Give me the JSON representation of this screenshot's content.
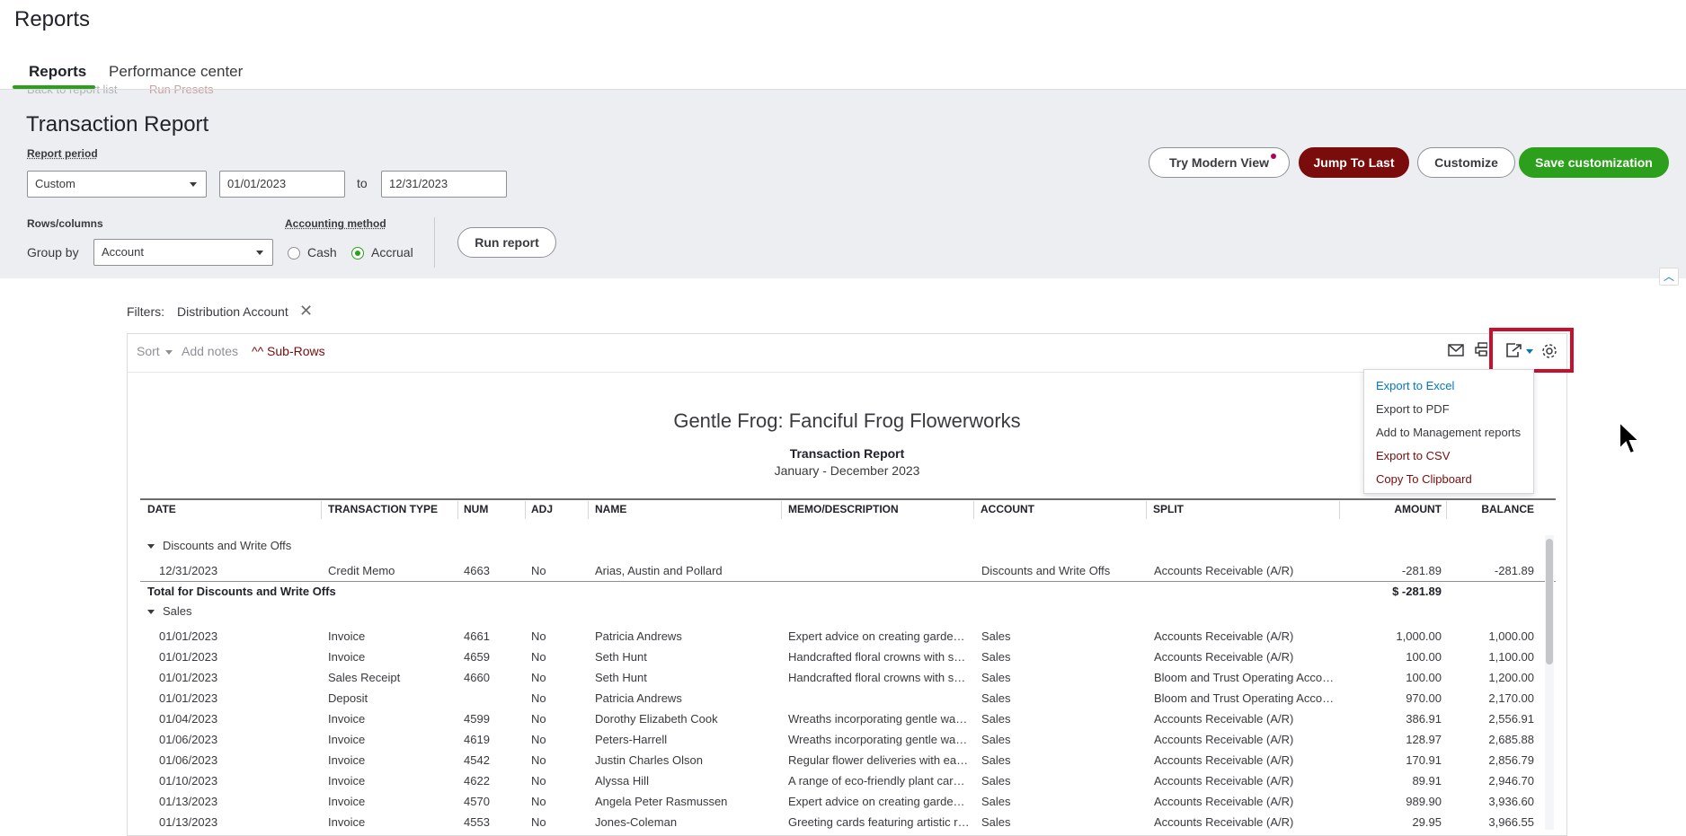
{
  "page_title": "Reports",
  "tabs": [
    {
      "label": "Reports",
      "active": true
    },
    {
      "label": "Performance center",
      "active": false
    }
  ],
  "breadcrumbs": {
    "back": "Back to report list",
    "presets": "Run Presets"
  },
  "report_heading": "Transaction Report",
  "report_period": {
    "label": "Report period",
    "selected": "Custom",
    "start_date": "01/01/2023",
    "to_label": "to",
    "end_date": "12/31/2023"
  },
  "rows_columns": {
    "label": "Rows/columns",
    "group_by_label": "Group by",
    "group_by_value": "Account"
  },
  "accounting_method": {
    "label": "Accounting method",
    "options": [
      "Cash",
      "Accrual"
    ],
    "selected": "Accrual"
  },
  "run_report_label": "Run report",
  "actions": {
    "modern_view": "Try Modern View",
    "jump_to_last": "Jump To Last",
    "customize": "Customize",
    "save_customization": "Save customization"
  },
  "filters": {
    "label": "Filters:",
    "chip": "Distribution Account",
    "remove": "✕"
  },
  "toolbar": {
    "sort": "Sort",
    "add_notes": "Add notes",
    "sub_rows": "^^ Sub-Rows",
    "icons": [
      "email-icon",
      "print-icon",
      "export-icon",
      "settings-icon"
    ]
  },
  "export_menu": [
    "Export to Excel",
    "Export to PDF",
    "Add to Management reports",
    "Export to CSV",
    "Copy To Clipboard"
  ],
  "report": {
    "company": "Gentle Frog: Fanciful Frog Flowerworks",
    "title": "Transaction Report",
    "date_range": "January - December 2023",
    "columns": [
      "DATE",
      "TRANSACTION TYPE",
      "NUM",
      "ADJ",
      "NAME",
      "MEMO/DESCRIPTION",
      "ACCOUNT",
      "SPLIT",
      "AMOUNT",
      "BALANCE"
    ],
    "groups": [
      {
        "name": "Discounts and Write Offs",
        "rows": [
          [
            "12/31/2023",
            "Credit Memo",
            "4663",
            "No",
            "Arias, Austin and Pollard",
            "",
            "Discounts and Write Offs",
            "Accounts Receivable (A/R)",
            "-281.89",
            "-281.89"
          ]
        ],
        "total_label": "Total for Discounts and Write Offs",
        "total_value": "$ -281.89"
      },
      {
        "name": "Sales",
        "rows": [
          [
            "01/01/2023",
            "Invoice",
            "4661",
            "No",
            "Patricia Andrews",
            "Expert advice on creating garde…",
            "Sales",
            "Accounts Receivable (A/R)",
            "1,000.00",
            "1,000.00"
          ],
          [
            "01/01/2023",
            "Invoice",
            "4659",
            "No",
            "Seth Hunt",
            "Handcrafted floral crowns with s…",
            "Sales",
            "Accounts Receivable (A/R)",
            "100.00",
            "1,100.00"
          ],
          [
            "01/01/2023",
            "Sales Receipt",
            "4660",
            "No",
            "Seth Hunt",
            "Handcrafted floral crowns with s…",
            "Sales",
            "Bloom and Trust Operating Acco…",
            "100.00",
            "1,200.00"
          ],
          [
            "01/01/2023",
            "Deposit",
            "",
            "No",
            "Patricia Andrews",
            "",
            "Sales",
            "Bloom and Trust Operating Acco…",
            "970.00",
            "2,170.00"
          ],
          [
            "01/04/2023",
            "Invoice",
            "4599",
            "No",
            "Dorothy Elizabeth Cook",
            "Wreaths incorporating gentle wa…",
            "Sales",
            "Accounts Receivable (A/R)",
            "386.91",
            "2,556.91"
          ],
          [
            "01/06/2023",
            "Invoice",
            "4619",
            "No",
            "Peters-Harrell",
            "Wreaths incorporating gentle wa…",
            "Sales",
            "Accounts Receivable (A/R)",
            "128.97",
            "2,685.88"
          ],
          [
            "01/06/2023",
            "Invoice",
            "4542",
            "No",
            "Justin Charles Olson",
            "Regular flower deliveries with ea…",
            "Sales",
            "Accounts Receivable (A/R)",
            "170.91",
            "2,856.79"
          ],
          [
            "01/10/2023",
            "Invoice",
            "4622",
            "No",
            "Alyssa Hill",
            "A range of eco-friendly plant car…",
            "Sales",
            "Accounts Receivable (A/R)",
            "89.91",
            "2,946.70"
          ],
          [
            "01/13/2023",
            "Invoice",
            "4570",
            "No",
            "Angela Peter Rasmussen",
            "Expert advice on creating garde…",
            "Sales",
            "Accounts Receivable (A/R)",
            "989.90",
            "3,936.60"
          ],
          [
            "01/13/2023",
            "Invoice",
            "4553",
            "No",
            "Jones-Coleman",
            "Greeting cards featuring artistic r…",
            "Sales",
            "Accounts Receivable (A/R)",
            "29.95",
            "3,966.55"
          ]
        ]
      }
    ]
  },
  "colors": {
    "brand_green": "#2ca01c",
    "jump_dark_red": "#7a0c0c",
    "highlight_red": "#c8102e",
    "link_blue": "#0077c5"
  }
}
